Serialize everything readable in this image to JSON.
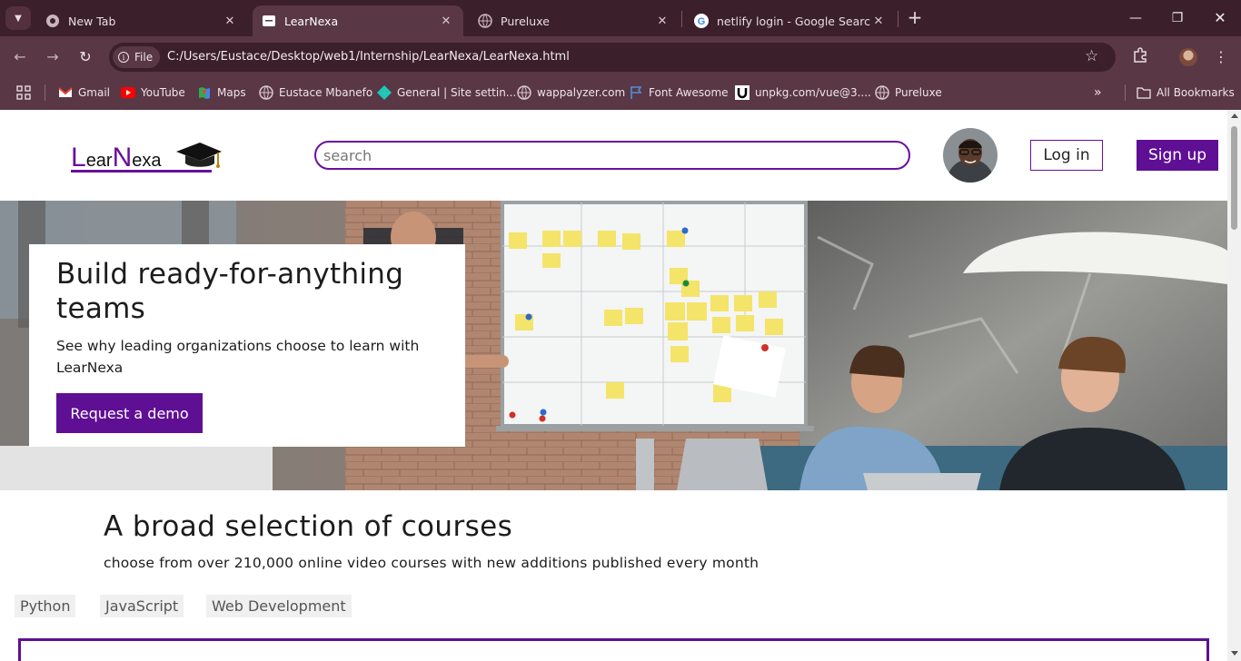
{
  "browser": {
    "tabs": [
      {
        "title": "New Tab",
        "icon": "chrome-icon",
        "active": false
      },
      {
        "title": "LearNexa",
        "icon": "page-icon",
        "active": true
      },
      {
        "title": "Pureluxe",
        "icon": "globe-icon",
        "active": false
      },
      {
        "title": "netlify login - Google Search",
        "icon": "google-icon",
        "active": false
      }
    ],
    "file_chip": "File",
    "url": "C:/Users/Eustace/Desktop/web1/Internship/LearNexa/LearNexa.html",
    "bookmarks": [
      {
        "label": "Gmail",
        "icon": "gmail-icon"
      },
      {
        "label": "YouTube",
        "icon": "youtube-icon"
      },
      {
        "label": "Maps",
        "icon": "maps-icon"
      },
      {
        "label": "Eustace Mbanefo",
        "icon": "globe-icon"
      },
      {
        "label": "General | Site settin...",
        "icon": "netlify-icon"
      },
      {
        "label": "wappalyzer.com",
        "icon": "globe-icon"
      },
      {
        "label": "Font Awesome",
        "icon": "flag-icon"
      },
      {
        "label": "unpkg.com/vue@3....",
        "icon": "unpkg-icon"
      },
      {
        "label": "Pureluxe",
        "icon": "globe-icon"
      }
    ],
    "all_bookmarks": "All Bookmarks",
    "colors": {
      "frame": "#3b1f2b",
      "toolbar": "#5a3745"
    }
  },
  "site": {
    "logo": {
      "part1": "L",
      "part2": "ear",
      "part3": "N",
      "part4": "exa"
    },
    "search": {
      "placeholder": "search",
      "value": ""
    },
    "login_label": "Log in",
    "signup_label": "Sign up",
    "accent_color": "#5f0f94"
  },
  "hero": {
    "title": "Build ready-for-anything teams",
    "subtitle": "See why leading organizations choose to learn with LearNexa",
    "cta_label": "Request a demo"
  },
  "courses": {
    "title": "A broad selection of courses",
    "subtitle": "choose from over 210,000 online video courses with new additions published every month",
    "topics": [
      "Python",
      "JavaScript",
      "Web Development"
    ]
  }
}
